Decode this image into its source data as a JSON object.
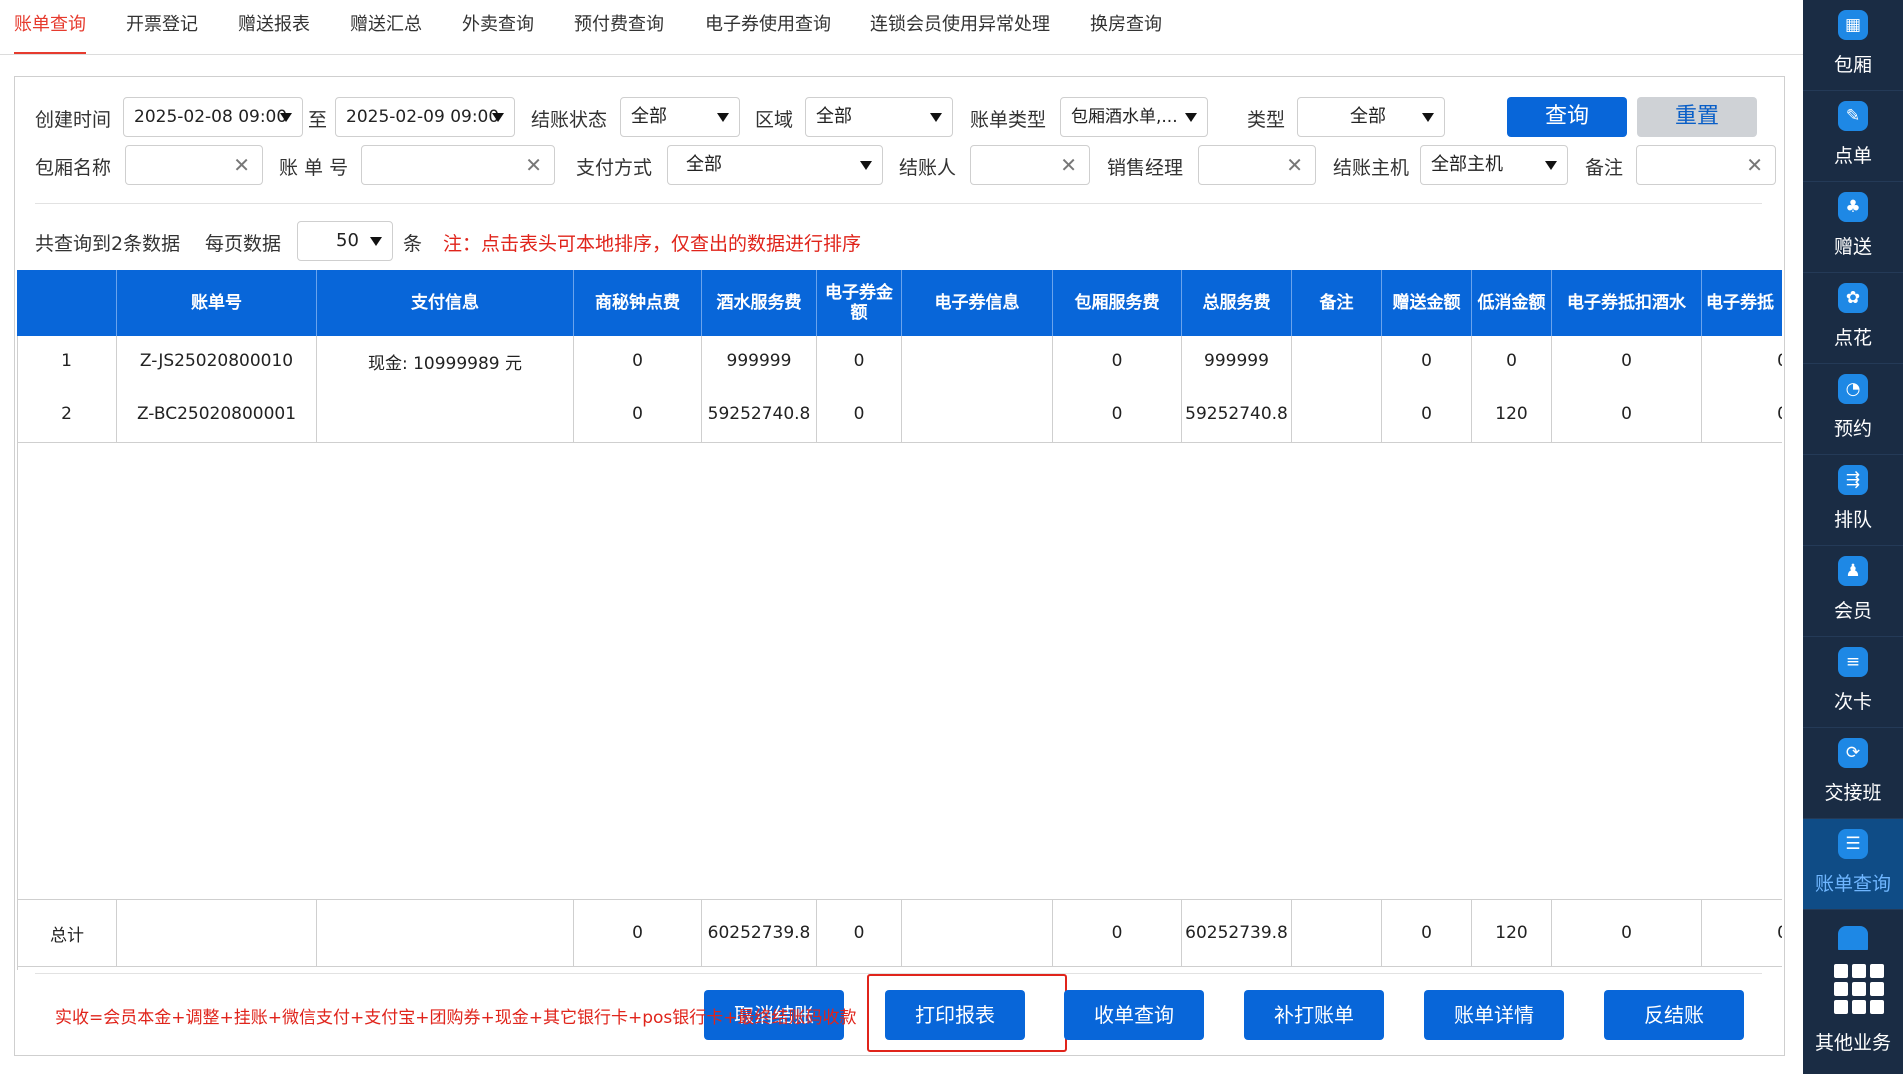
{
  "tabs": [
    {
      "label": "账单查询",
      "active": true
    },
    {
      "label": "开票登记"
    },
    {
      "label": "赠送报表"
    },
    {
      "label": "赠送汇总"
    },
    {
      "label": "外卖查询"
    },
    {
      "label": "预付费查询"
    },
    {
      "label": "电子券使用查询"
    },
    {
      "label": "连锁会员使用异常处理"
    },
    {
      "label": "换房查询"
    }
  ],
  "filters": {
    "create_time_label": "创建时间",
    "start_time": "2025-02-08 09:00",
    "to_label": "至",
    "end_time": "2025-02-09 09:00",
    "status_label": "结账状态",
    "status_value": "全部",
    "area_label": "区域",
    "area_value": "全部",
    "bill_type_label": "账单类型",
    "bill_type_value": "包厢酒水单,...",
    "type_label": "类型",
    "type_value": "全部",
    "query_button": "查询",
    "reset_button": "重置",
    "room_name_label": "包厢名称",
    "bill_no_label": "账 单 号",
    "pay_method_label": "支付方式",
    "pay_method_value": "全部",
    "cashier_label": "结账人",
    "sales_manager_label": "销售经理",
    "host_label": "结账主机",
    "host_value": "全部主机",
    "remark_label": "备注",
    "clear_glyph": "✕"
  },
  "summary": {
    "total_text": "共查询到2条数据",
    "per_page_label": "每页数据",
    "per_page_value": "50",
    "unit": "条",
    "note": "注：点击表头可本地排序，仅查出的数据进行排序"
  },
  "table": {
    "headers": [
      "",
      "账单号",
      "支付信息",
      "商秘钟点费",
      "酒水服务费",
      "电子券金额",
      "电子券信息",
      "包厢服务费",
      "总服务费",
      "备注",
      "赠送金额",
      "低消金额",
      "电子券抵扣酒水",
      "电子券抵"
    ],
    "rows": [
      [
        "1",
        "Z-JS25020800010",
        "现金: 10999989 元",
        "0",
        "999999",
        "0",
        "",
        "0",
        "999999",
        "",
        "0",
        "0",
        "0",
        "0"
      ],
      [
        "2",
        "Z-BC25020800001",
        "",
        "0",
        "59252740.8",
        "0",
        "",
        "0",
        "59252740.8",
        "",
        "0",
        "120",
        "0",
        "0"
      ]
    ],
    "total_row": [
      "总计",
      "",
      "",
      "0",
      "60252739.8",
      "0",
      "",
      "0",
      "60252739.8",
      "",
      "0",
      "120",
      "0",
      "0"
    ]
  },
  "footer": {
    "formula": "实收=会员本金+调整+挂账+微信支付+支付宝+团购券+现金+其它银行卡+pos银行卡+最终结账码收款",
    "buttons": [
      "取消结账",
      "打印报表",
      "收单查询",
      "补打账单",
      "账单详情",
      "反结账"
    ]
  },
  "sidebar": {
    "items": [
      {
        "label": "包厢",
        "icon": "▦"
      },
      {
        "label": "点单",
        "icon": "✎"
      },
      {
        "label": "赠送",
        "icon": "♣"
      },
      {
        "label": "点花",
        "icon": "✿"
      },
      {
        "label": "预约",
        "icon": "◔"
      },
      {
        "label": "排队",
        "icon": "⇶"
      },
      {
        "label": "会员",
        "icon": "♟"
      },
      {
        "label": "次卡",
        "icon": "≡"
      },
      {
        "label": "交接班",
        "icon": "⟳"
      },
      {
        "label": "账单查询",
        "icon": "☰",
        "active": true
      }
    ],
    "more_label": "其他业务"
  },
  "colors": {
    "accent": "#0866d9",
    "active_tab": "#e63b2e",
    "sidebar": "#1a2c44",
    "highlight": "#e0241b"
  }
}
